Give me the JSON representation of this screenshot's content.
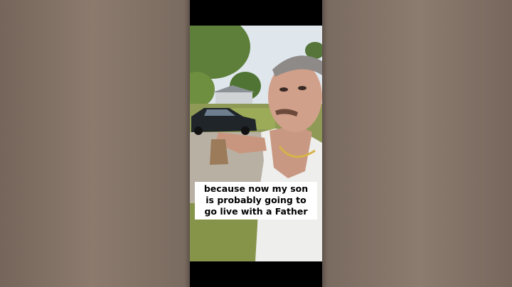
{
  "video": {
    "caption": {
      "line1": "because now my son",
      "line2": "is probably going to",
      "line3": "go live with a Father"
    }
  },
  "colors": {
    "letterbox": "#000000",
    "blurred_side": "#7d6b5d",
    "caption_bg": "#ffffff",
    "caption_text": "#000000"
  }
}
